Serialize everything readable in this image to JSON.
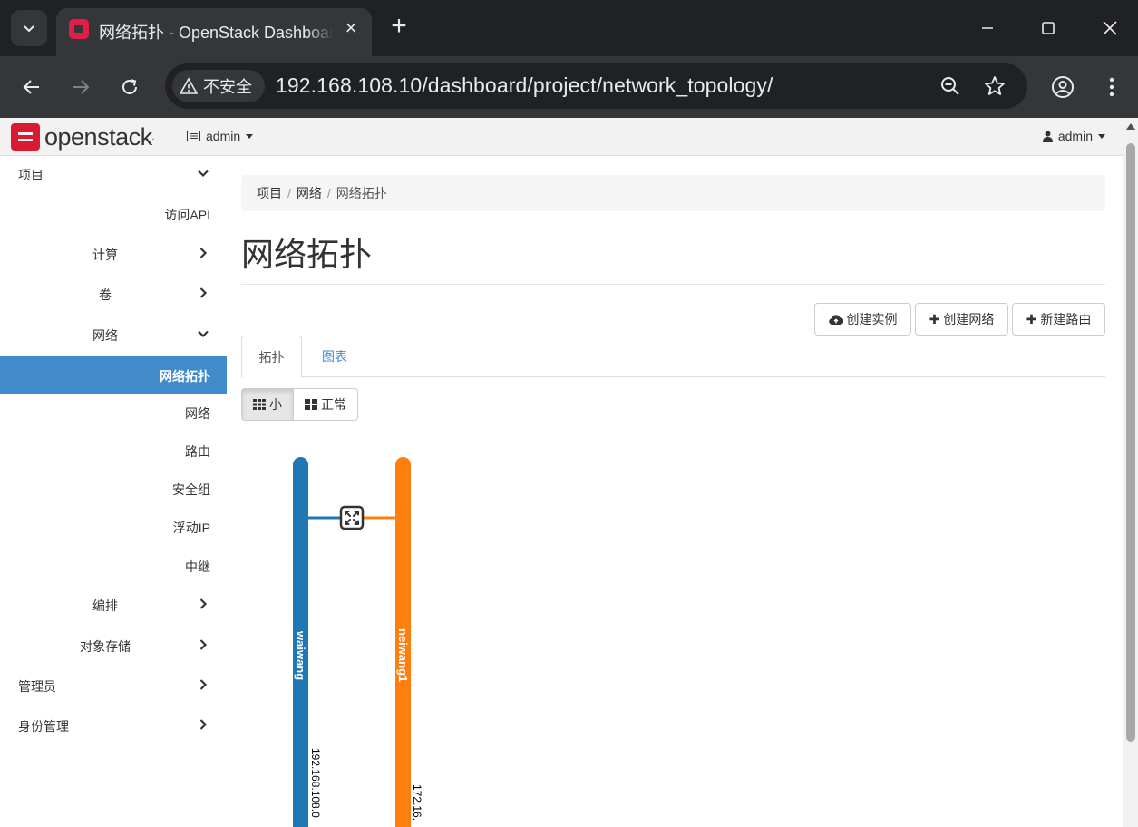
{
  "browser": {
    "tab_title": "网络拓扑 - OpenStack Dashboard",
    "url": "192.168.108.10/dashboard/project/network_topology/",
    "security_label": "不安全"
  },
  "navbar": {
    "logo_text": "openstack",
    "project_label": "admin",
    "user_label": "admin"
  },
  "sidebar": {
    "items": [
      {
        "label": "项目",
        "level": 0,
        "chevron": "down"
      },
      {
        "label": "访问API",
        "level": 2
      },
      {
        "label": "计算",
        "level": 1,
        "chevron": "right"
      },
      {
        "label": "卷",
        "level": 1,
        "chevron": "right"
      },
      {
        "label": "网络",
        "level": 1,
        "chevron": "down"
      },
      {
        "label": "网络拓扑",
        "level": 2,
        "active": true
      },
      {
        "label": "网络",
        "level": 2
      },
      {
        "label": "路由",
        "level": 2
      },
      {
        "label": "安全组",
        "level": 2
      },
      {
        "label": "浮动IP",
        "level": 2
      },
      {
        "label": "中继",
        "level": 2
      },
      {
        "label": "编排",
        "level": 1,
        "chevron": "right"
      },
      {
        "label": "对象存储",
        "level": 1,
        "chevron": "right"
      },
      {
        "label": "管理员",
        "level": 0,
        "chevron": "right"
      },
      {
        "label": "身份管理",
        "level": 0,
        "chevron": "right"
      }
    ]
  },
  "breadcrumb": [
    "项目",
    "网络",
    "网络拓扑"
  ],
  "page_title": "网络拓扑",
  "actions": {
    "create_instance": "创建实例",
    "create_network": "创建网络",
    "create_router": "新建路由"
  },
  "tabs": {
    "topology": "拓扑",
    "graph": "图表"
  },
  "view_toggle": {
    "small": "小",
    "normal": "正常"
  },
  "topology": {
    "networks": [
      {
        "name": "waiwang",
        "cidr": "192.168.108.0",
        "color": "#1f77b4"
      },
      {
        "name": "neiwang1",
        "cidr": "172.16.",
        "color": "#ff7f0e"
      }
    ]
  },
  "colors": {
    "accent": "#428bca",
    "brand": "#da1a32"
  }
}
